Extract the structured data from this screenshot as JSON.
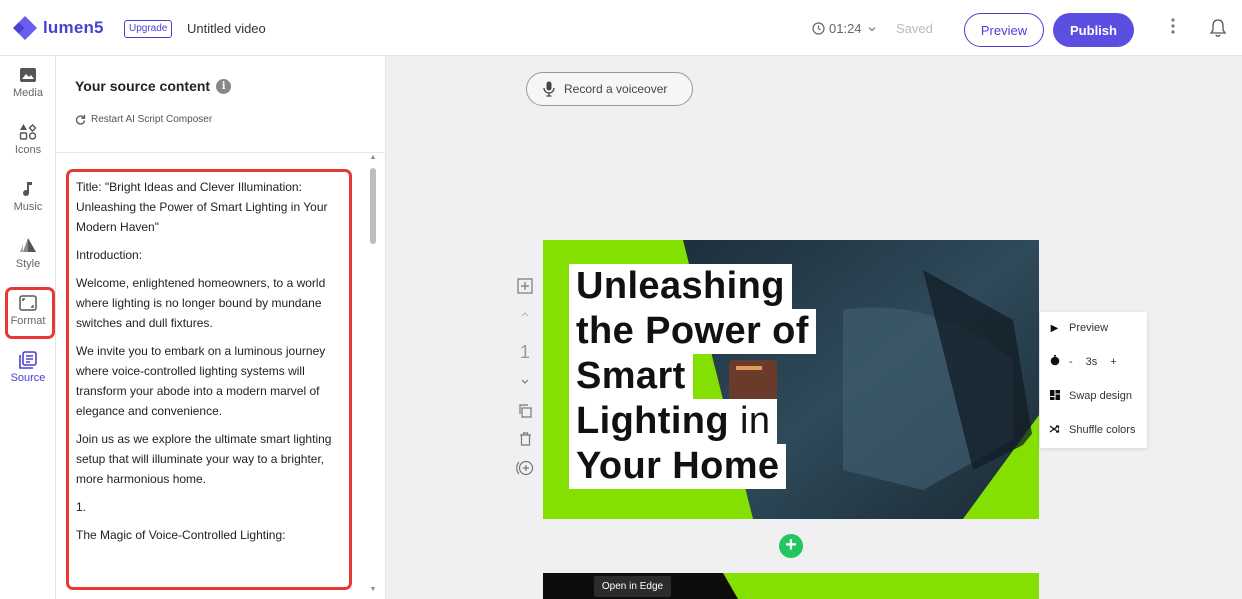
{
  "app": {
    "logo_text": "lumen5",
    "upgrade_label": "Upgrade",
    "video_title": "Untitled video",
    "duration": "01:24",
    "save_status": "Saved",
    "preview_label": "Preview",
    "publish_label": "Publish",
    "brand_color": "#4b40d4"
  },
  "rail": {
    "items": [
      {
        "label": "Media",
        "icon": "image-icon"
      },
      {
        "label": "Icons",
        "icon": "shapes-icon"
      },
      {
        "label": "Music",
        "icon": "music-note-icon"
      },
      {
        "label": "Style",
        "icon": "style-icon"
      },
      {
        "label": "Format",
        "icon": "aspect-ratio-icon"
      },
      {
        "label": "Source",
        "icon": "document-stack-icon"
      }
    ]
  },
  "source_panel": {
    "title": "Your source content",
    "info_glyph": "i",
    "restart_label": "Restart AI Script Composer",
    "paragraphs": [
      "Title: \"Bright Ideas and Clever Illumination: Unleashing the Power of Smart Lighting in Your Modern Haven\"",
      "Introduction:",
      "Welcome, enlightened homeowners, to a world where lighting is no longer bound by mundane switches and dull fixtures.",
      "We invite you to embark on a luminous journey where voice-controlled lighting systems will transform your abode into a modern marvel of elegance and convenience.",
      "Join us as we explore the ultimate smart lighting setup that will illuminate your way to a brighter, more harmonious home.",
      "1.",
      "The Magic of Voice-Controlled Lighting:"
    ]
  },
  "canvas": {
    "voiceover_label": "Record a voiceover",
    "scene_number": "1",
    "slide_lines": {
      "l1": "Unleashing",
      "l2": "the Power of",
      "l3": "Smart",
      "l4a": "Lighting",
      "l4b": " in",
      "l5": "Your Home"
    },
    "slide_accent": "#84e000",
    "context_menu": {
      "preview": "Preview",
      "minus": "-",
      "duration": "3s",
      "plus": "+",
      "swap": "Swap design",
      "shuffle": "Shuffle colors"
    },
    "add_glyph": "+",
    "tooltip": "Open in Edge"
  }
}
